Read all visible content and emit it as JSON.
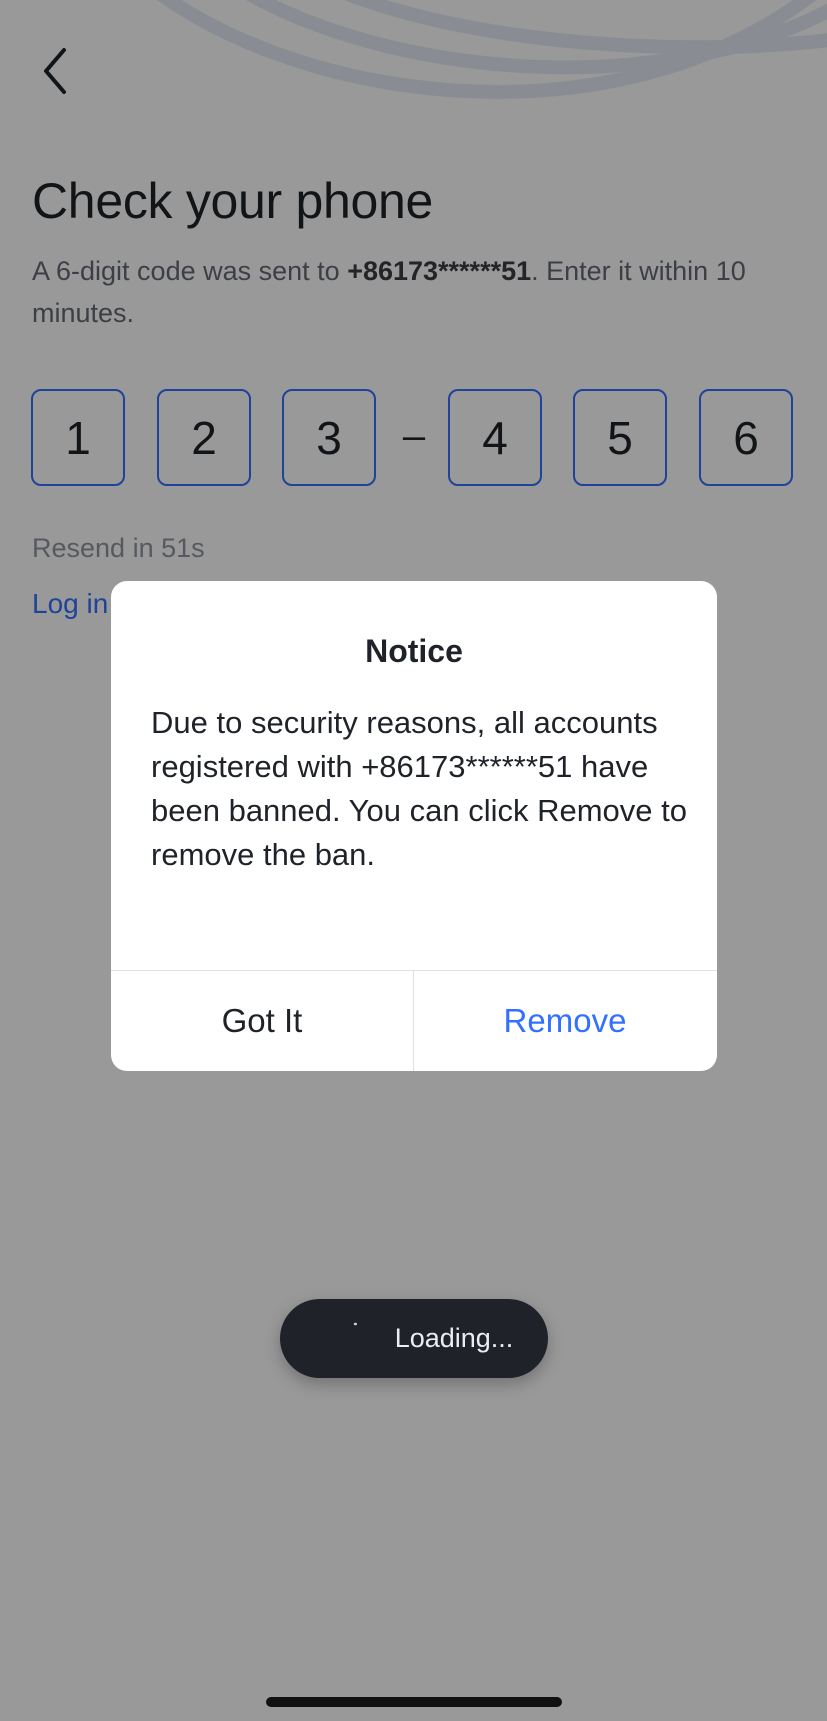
{
  "header": {
    "back_icon": "chevron-left-icon",
    "title": "Check your phone"
  },
  "subtitle": {
    "prefix": "A 6-digit code was sent to ",
    "phone": "+86173******51",
    "suffix": ". Enter it within 10 minutes."
  },
  "code": {
    "digits": [
      "1",
      "2",
      "3",
      "4",
      "5",
      "6"
    ],
    "separator": "–"
  },
  "resend_text": "Resend in 51s",
  "login_link_text": "Log in",
  "dialog": {
    "title": "Notice",
    "body": "Due to security reasons, all accounts registered with +86173******51 have been banned. You can click Remove to remove the ban.",
    "got_it_label": "Got It",
    "remove_label": "Remove"
  },
  "toast": {
    "icon": "spinner-icon",
    "text": "Loading..."
  },
  "colors": {
    "accent": "#3370ff",
    "text_primary": "#1f2329",
    "text_secondary": "#646a73",
    "overlay": "rgba(0,0,0,0.4)",
    "toast_bg": "#1f2329"
  }
}
